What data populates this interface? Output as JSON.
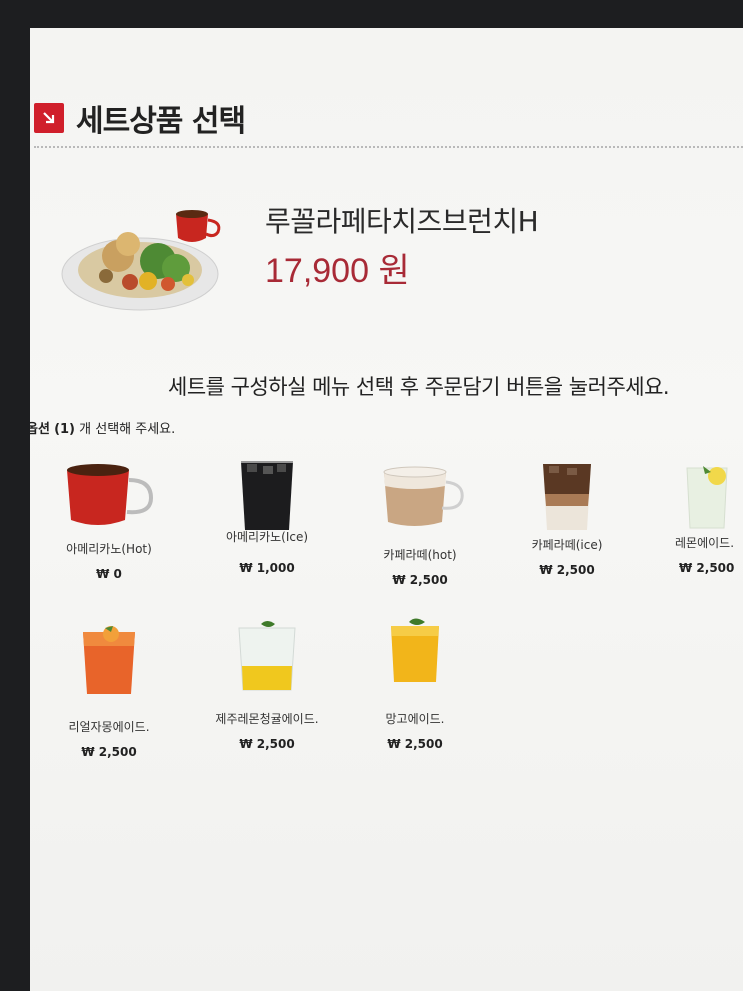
{
  "header": {
    "title": "세트상품 선택",
    "icon": "arrow-down-right-icon",
    "accent_color": "#d01f2b"
  },
  "product": {
    "name": "루꼴라페타치즈브런치H",
    "price": "17,900 원",
    "price_color": "#a82a36"
  },
  "instruction": "세트를 구성하실 메뉴 선택 후 주문담기 버튼을 눌러주세요.",
  "option": {
    "prefix": "옵션",
    "count": "(1)",
    "suffix": "개 선택해 주세요."
  },
  "menu": [
    {
      "name": "아메리카노(Hot)",
      "price": "₩ 0",
      "icon": "hot-americano-cup-icon"
    },
    {
      "name": "아메리카노(Ice)",
      "price": "₩ 1,000",
      "icon": "iced-americano-glass-icon"
    },
    {
      "name": "카페라떼(hot)",
      "price": "₩ 2,500",
      "icon": "hot-latte-glass-icon"
    },
    {
      "name": "카페라떼(ice)",
      "price": "₩ 2,500",
      "icon": "iced-latte-glass-icon"
    },
    {
      "name": "레몬에이드.",
      "price": "₩ 2,500",
      "icon": "lemonade-glass-icon"
    },
    {
      "name": "리얼자몽에이드.",
      "price": "₩ 2,500",
      "icon": "grapefruit-ade-glass-icon"
    },
    {
      "name": "제주레몬청귤에이드.",
      "price": "₩ 2,500",
      "icon": "jeju-lemon-tangerine-ade-glass-icon"
    },
    {
      "name": "망고에이드.",
      "price": "₩ 2,500",
      "icon": "mango-ade-glass-icon"
    }
  ]
}
